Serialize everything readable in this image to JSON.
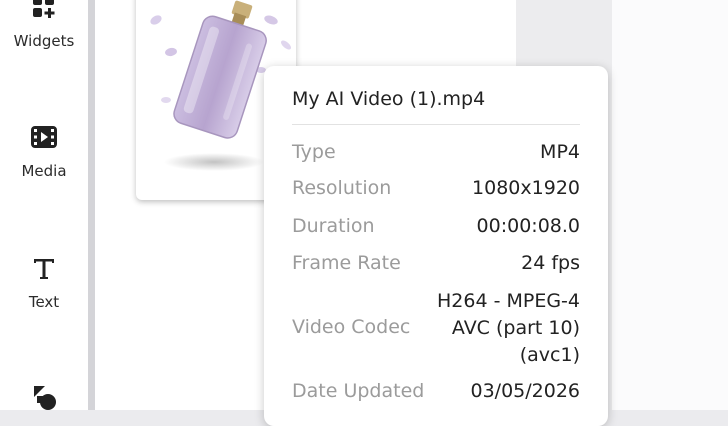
{
  "sidebar": {
    "items": [
      {
        "label": "Widgets",
        "icon": "widgets-icon"
      },
      {
        "label": "Media",
        "icon": "media-icon"
      },
      {
        "label": "Text",
        "icon": "text-icon"
      },
      {
        "label": "",
        "icon": "shapes-icon"
      }
    ]
  },
  "file_info": {
    "title": "My AI Video (1).mp4",
    "rows": [
      {
        "key": "Type",
        "value": "MP4"
      },
      {
        "key": "Resolution",
        "value": "1080x1920"
      },
      {
        "key": "Duration",
        "value": "00:00:08.0"
      },
      {
        "key": "Frame Rate",
        "value": "24 fps"
      },
      {
        "key": "Video Codec",
        "value_lines": [
          "H264 - MPEG-4",
          "AVC (part 10)",
          "(avc1)"
        ]
      },
      {
        "key": "Date Updated",
        "value": "03/05/2026"
      }
    ]
  },
  "colors": {
    "accent": "#d4d4d8",
    "perfume_glass": "#b9a6cf"
  }
}
